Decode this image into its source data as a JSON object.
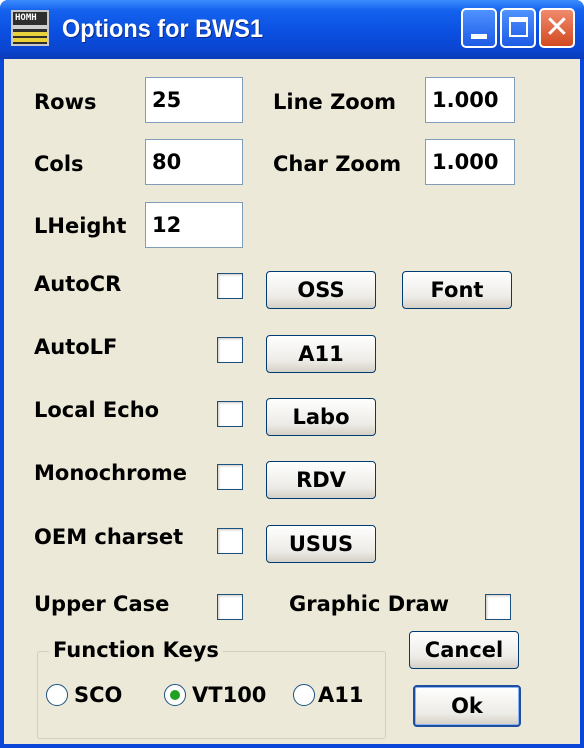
{
  "window": {
    "title": "Options for BWS1",
    "icon_text": "HOMH",
    "icon": "terminal-app-icon",
    "controls": [
      "minimize-icon",
      "maximize-icon",
      "close-icon"
    ],
    "close_glyph": "✕",
    "title_color": "#0a46d8",
    "face_color": "#ece9d8"
  },
  "fields": {
    "rows_label": "Rows",
    "rows_value": "25",
    "cols_label": "Cols",
    "cols_value": "80",
    "lheight_label": "LHeight",
    "lheight_value": "12",
    "line_zoom_label": "Line Zoom",
    "line_zoom_value": "1.000",
    "char_zoom_label": "Char Zoom",
    "char_zoom_value": "1.000"
  },
  "checkboxes": {
    "autocr": {
      "label": "AutoCR",
      "checked": false
    },
    "autolf": {
      "label": "AutoLF",
      "checked": false
    },
    "local_echo": {
      "label": "Local Echo",
      "checked": false
    },
    "monochrome": {
      "label": "Monochrome",
      "checked": false
    },
    "oem_charset": {
      "label": "OEM charset",
      "checked": false
    },
    "upper_case": {
      "label": "Upper Case",
      "checked": false
    },
    "graphic_draw": {
      "label": "Graphic Draw",
      "checked": false
    }
  },
  "buttons": {
    "oss": "OSS",
    "font": "Font",
    "a11": "A11",
    "labo": "Labo",
    "rdv": "RDV",
    "usus": "USUS",
    "cancel": "Cancel",
    "ok": "Ok"
  },
  "function_keys": {
    "title": "Function Keys",
    "options": [
      "SCO",
      "VT100",
      "A11"
    ],
    "selected": "VT100"
  }
}
